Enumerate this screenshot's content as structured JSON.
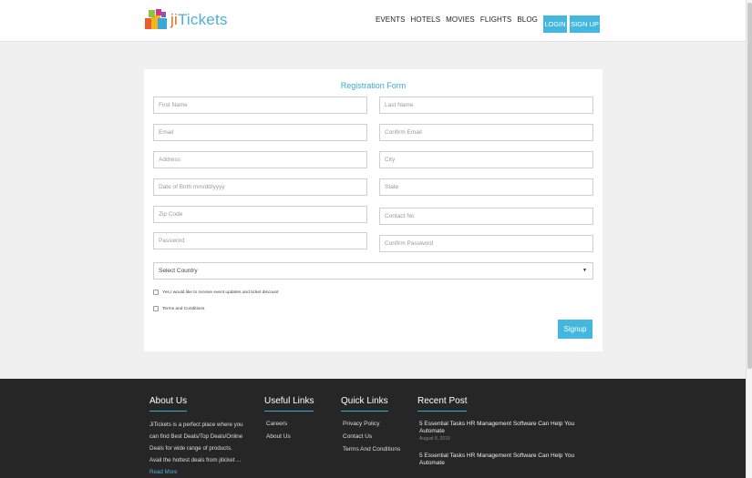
{
  "brand": {
    "name_prefix": "ji",
    "name_suffix": "Tickets",
    "primary_color": "#44b7de",
    "logo_icon": "ticket-stack-icon"
  },
  "nav": {
    "items": [
      "EVENTS",
      "HOTELS",
      "MOVIES",
      "FLIGHTS",
      "BLOG"
    ],
    "login_label": "LOGIN",
    "signup_label": "SIGN UP"
  },
  "form": {
    "title": "Registration Form",
    "fields": {
      "first_name": "First Name",
      "last_name": "Last Name",
      "email": "Email",
      "confirm_email": "Confirm Email",
      "address": "Address",
      "city": "City",
      "dob": "Date of Birth mm/dd/yyyy",
      "state": "State",
      "zip": "Zip Code",
      "contact": "Contact No",
      "password": "Password",
      "confirm_password": "Confirm Password"
    },
    "country_select": "Select Country",
    "newsletter_label": "Yes,I would like to receive event updates and ticket discount",
    "terms_label": "Terms and Conditions",
    "submit_label": "Signup"
  },
  "footer": {
    "about": {
      "heading": "About Us",
      "text": "JiTickets is a perfect place where you can find Best Deals/Top Deals/Online Deals for wide range of products. Avail the hottest deals from jiticket ... ",
      "more": "Read More"
    },
    "useful_links": {
      "heading": "Useful Links",
      "items": [
        "Careers",
        "About Us"
      ]
    },
    "quick_links": {
      "heading": "Quick Links",
      "items": [
        "Privacy Policy",
        "Contact Us",
        "Terms And Conditions"
      ]
    },
    "recent_post": {
      "heading": "Recent Post",
      "posts": [
        {
          "title": "5 Essential Tasks HR Management Software Can Help You Automate",
          "date": "August 8, 2019"
        },
        {
          "title": "5 Essential Tasks HR Management Software Can Help You Automate",
          "date": ""
        }
      ]
    }
  }
}
